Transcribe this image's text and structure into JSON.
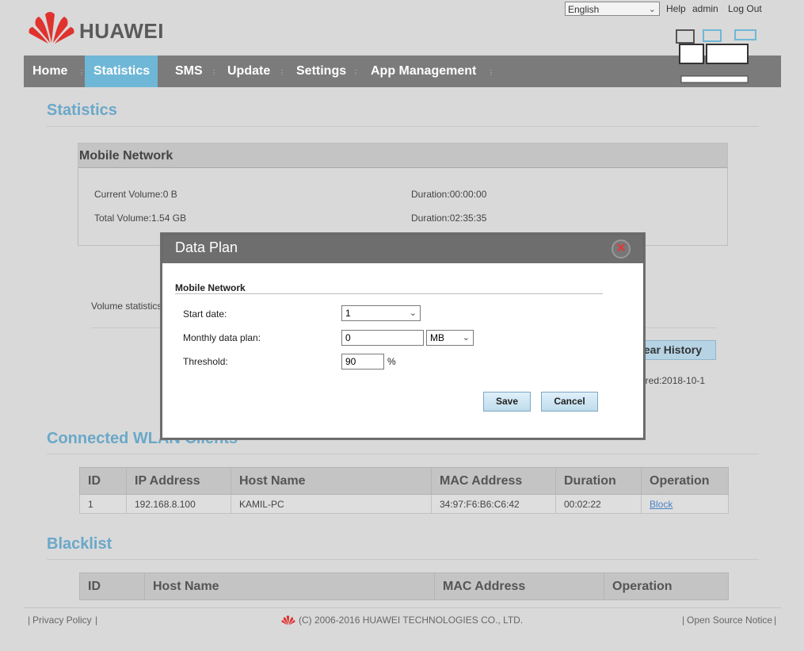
{
  "header": {
    "language": "English",
    "help": "Help",
    "user": "admin",
    "logout": "Log Out",
    "brand": "HUAWEI",
    "brand_color": "#e0322e"
  },
  "nav": {
    "items": [
      {
        "label": "Home"
      },
      {
        "label": "Statistics"
      },
      {
        "label": "SMS"
      },
      {
        "label": "Update"
      },
      {
        "label": "Settings"
      },
      {
        "label": "App Management"
      }
    ],
    "active": "Statistics",
    "active_color": "#6fb7d7"
  },
  "statistics": {
    "title": "Statistics",
    "mobile_network_title": "Mobile Network",
    "current_volume": "Current Volume:0 B",
    "current_duration": "Duration:00:00:00",
    "total_volume": "Total Volume:1.54 GB",
    "total_duration": "Duration:02:35:35",
    "volume_stats_label": "Volume statistics",
    "clear_history": "lear History",
    "cleared_text": "ared:2018-10-1"
  },
  "wlan": {
    "title": "Connected WLAN Clients",
    "columns": [
      "ID",
      "IP Address",
      "Host Name",
      "MAC Address",
      "Duration",
      "Operation"
    ],
    "rows": [
      {
        "id": "1",
        "ip": "192.168.8.100",
        "host": "KAMIL-PC",
        "mac": "34:97:F6:B6:C6:42",
        "duration": "00:02:22",
        "operation": "Block"
      }
    ]
  },
  "blacklist": {
    "title": "Blacklist",
    "columns": [
      "ID",
      "Host Name",
      "MAC Address",
      "Operation"
    ]
  },
  "footer": {
    "privacy": "Privacy Policy",
    "copyright": "(C) 2006-2016 HUAWEI TECHNOLOGIES CO., LTD.",
    "open_source": "Open Source Notice"
  },
  "modal": {
    "title": "Data Plan",
    "section": "Mobile Network",
    "start_date_label": "Start date:",
    "start_date_value": "1",
    "monthly_plan_label": "Monthly data plan:",
    "monthly_plan_value": "0",
    "monthly_plan_unit": "MB",
    "threshold_label": "Threshold:",
    "threshold_value": "90",
    "threshold_unit": "%",
    "save": "Save",
    "cancel": "Cancel"
  }
}
